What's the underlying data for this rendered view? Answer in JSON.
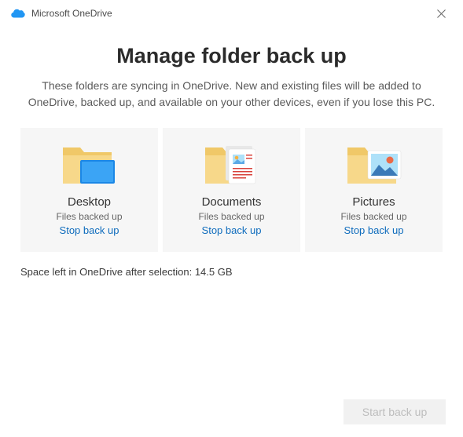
{
  "titlebar": {
    "app_name": "Microsoft OneDrive"
  },
  "main": {
    "title": "Manage folder back up",
    "description": "These folders are syncing in OneDrive. New and existing files will be added to OneDrive, backed up, and available on your other devices, even if you lose this PC."
  },
  "folders": [
    {
      "name": "Desktop",
      "status": "Files backed up",
      "action": "Stop back up"
    },
    {
      "name": "Documents",
      "status": "Files backed up",
      "action": "Stop back up"
    },
    {
      "name": "Pictures",
      "status": "Files backed up",
      "action": "Stop back up"
    }
  ],
  "space_left": "Space left in OneDrive after selection: 14.5 GB",
  "footer": {
    "start_button": "Start back up"
  }
}
